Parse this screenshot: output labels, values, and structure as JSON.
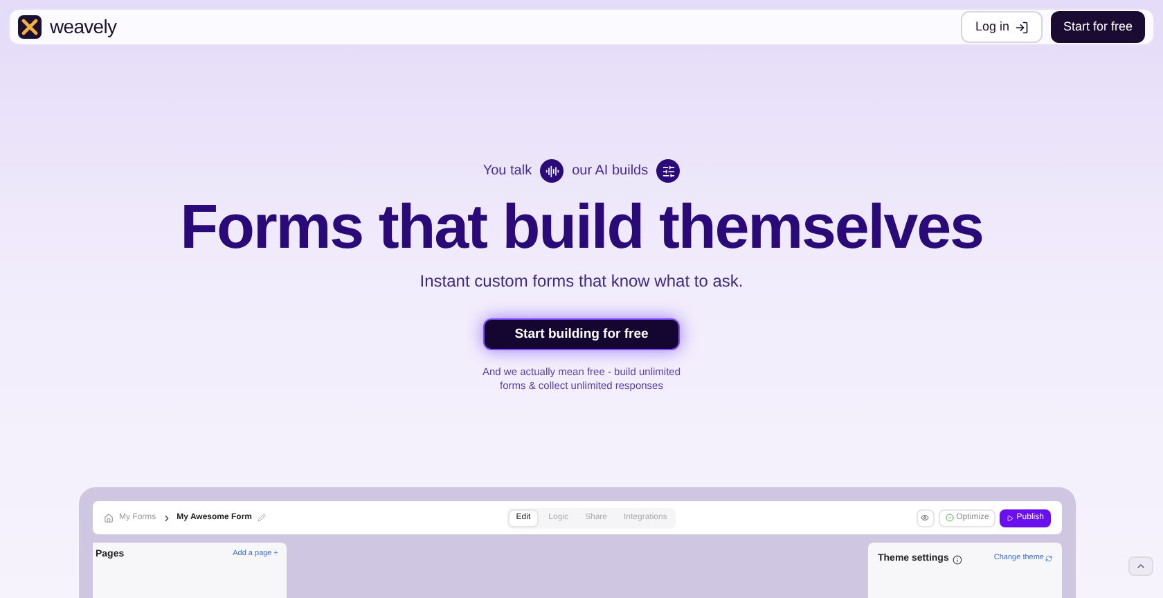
{
  "header": {
    "brand": "weavely",
    "login": "Log in",
    "cta": "Start for free"
  },
  "hero": {
    "talk": "You talk",
    "builds": "our AI builds",
    "title": "Forms that build themselves",
    "subtitle": "Instant custom forms that know what to ask.",
    "button": "Start building for free",
    "note_lines": [
      "And we actually mean free - build unlimited",
      "forms & collect unlimited responses"
    ]
  },
  "preview": {
    "breadcrumb": {
      "parent": "My Forms",
      "current": "My Awesome Form"
    },
    "tabs": [
      {
        "label": "Edit",
        "selected": true
      },
      {
        "label": "Logic",
        "selected": false
      },
      {
        "label": "Share",
        "selected": false
      },
      {
        "label": "Integrations",
        "selected": false
      }
    ],
    "optimize": "Optimize",
    "publish": "Publish",
    "pages_title": "Pages",
    "add_page": "Add a page +",
    "theme_title": "Theme settings",
    "change_theme": "Change theme"
  }
}
